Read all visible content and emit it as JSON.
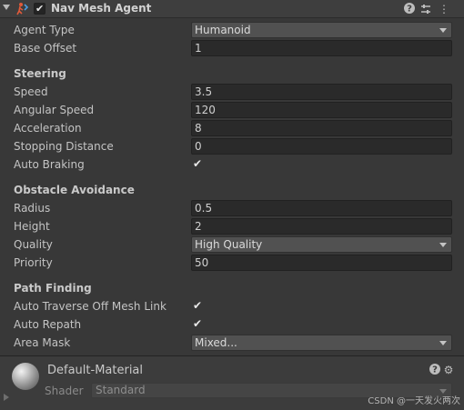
{
  "header": {
    "title": "Nav Mesh Agent",
    "enabled": true,
    "icons": [
      "help-icon",
      "presets-icon",
      "more-options-icon"
    ]
  },
  "fields": {
    "agent_type": {
      "label": "Agent Type",
      "value": "Humanoid"
    },
    "base_offset": {
      "label": "Base Offset",
      "value": "1"
    }
  },
  "steering": {
    "title": "Steering",
    "speed": {
      "label": "Speed",
      "value": "3.5"
    },
    "angular_speed": {
      "label": "Angular Speed",
      "value": "120"
    },
    "acceleration": {
      "label": "Acceleration",
      "value": "8"
    },
    "stopping_distance": {
      "label": "Stopping Distance",
      "value": "0"
    },
    "auto_braking": {
      "label": "Auto Braking",
      "checked": true
    }
  },
  "obstacle": {
    "title": "Obstacle Avoidance",
    "radius": {
      "label": "Radius",
      "value": "0.5"
    },
    "height": {
      "label": "Height",
      "value": "2"
    },
    "quality": {
      "label": "Quality",
      "value": "High Quality"
    },
    "priority": {
      "label": "Priority",
      "value": "50"
    }
  },
  "pathfinding": {
    "title": "Path Finding",
    "auto_traverse": {
      "label": "Auto Traverse Off Mesh Link",
      "checked": true
    },
    "auto_repath": {
      "label": "Auto Repath",
      "checked": true
    },
    "area_mask": {
      "label": "Area Mask",
      "value": "Mixed..."
    }
  },
  "material": {
    "name": "Default-Material",
    "shader_label": "Shader",
    "shader_value": "Standard"
  },
  "watermark": "CSDN @一天发火两次",
  "glyphs": {
    "check": "✔",
    "help": "?",
    "presets": "⇵",
    "more": "⋮",
    "gear": "⚙"
  }
}
